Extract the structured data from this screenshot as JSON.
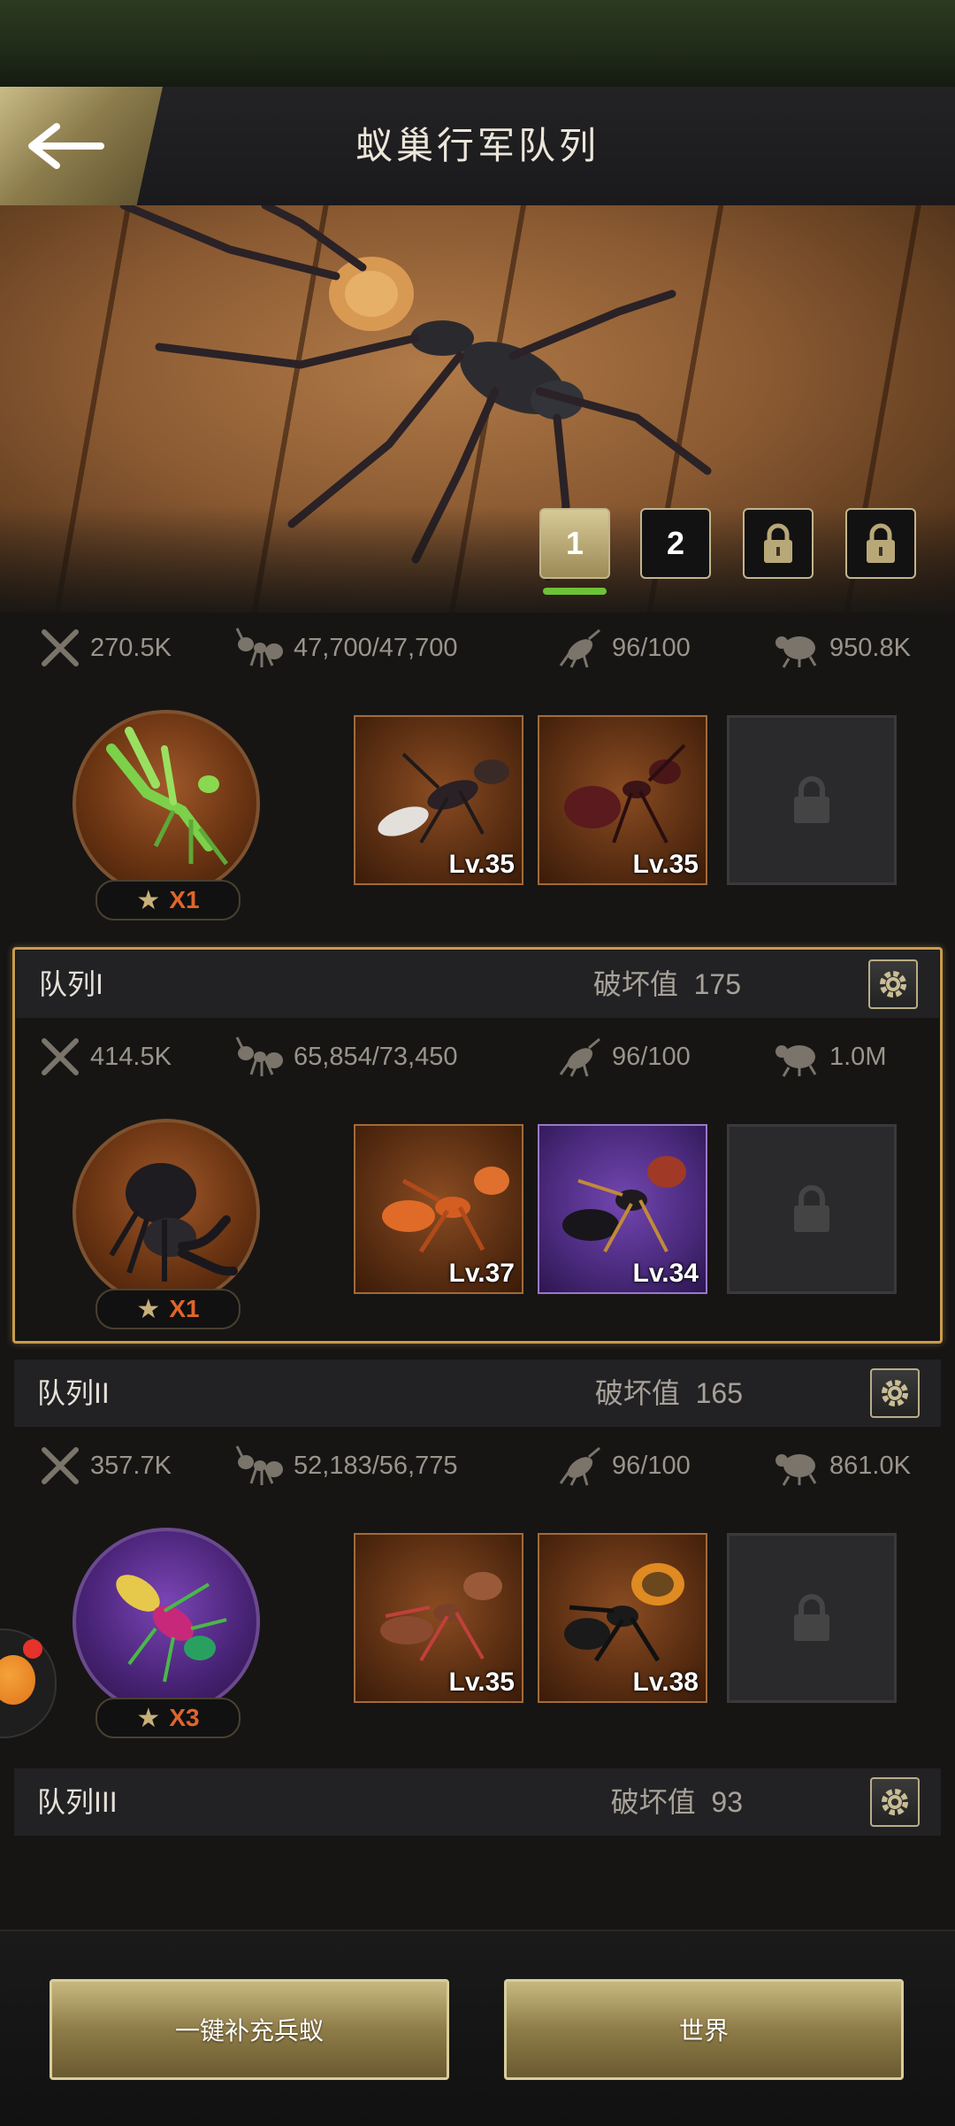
{
  "header": {
    "title": "蚁巢行军队列"
  },
  "hero": {
    "tabs": [
      "1",
      "2"
    ],
    "active_tab": "1"
  },
  "colors": {
    "accent_gold": "#c89c4c",
    "active_tab_underline": "#6ec236",
    "badge_orange": "#e0652a"
  },
  "squads": [
    {
      "queue_name": "",
      "stats": {
        "attack": "270.5K",
        "troops": "47,700/47,700",
        "load": "96/100",
        "power": "950.8K"
      },
      "commander": {
        "badge": "X1"
      },
      "slots": [
        {
          "level": "Lv.35"
        },
        {
          "level": "Lv.35"
        }
      ]
    },
    {
      "queue_name": "队列I",
      "damage_label": "破坏值",
      "damage_value": "175",
      "stats": {
        "attack": "414.5K",
        "troops": "65,854/73,450",
        "load": "96/100",
        "power": "1.0M"
      },
      "commander": {
        "badge": "X1"
      },
      "slots": [
        {
          "level": "Lv.37"
        },
        {
          "level": "Lv.34"
        }
      ]
    },
    {
      "queue_name": "队列II",
      "damage_label": "破坏值",
      "damage_value": "165",
      "stats": {
        "attack": "357.7K",
        "troops": "52,183/56,775",
        "load": "96/100",
        "power": "861.0K"
      },
      "commander": {
        "badge": "X3"
      },
      "slots": [
        {
          "level": "Lv.35"
        },
        {
          "level": "Lv.38"
        }
      ]
    },
    {
      "queue_name": "队列III",
      "damage_label": "破坏值",
      "damage_value": "93"
    }
  ],
  "buttons": {
    "refill": "一键补充兵蚁",
    "world": "世界"
  }
}
